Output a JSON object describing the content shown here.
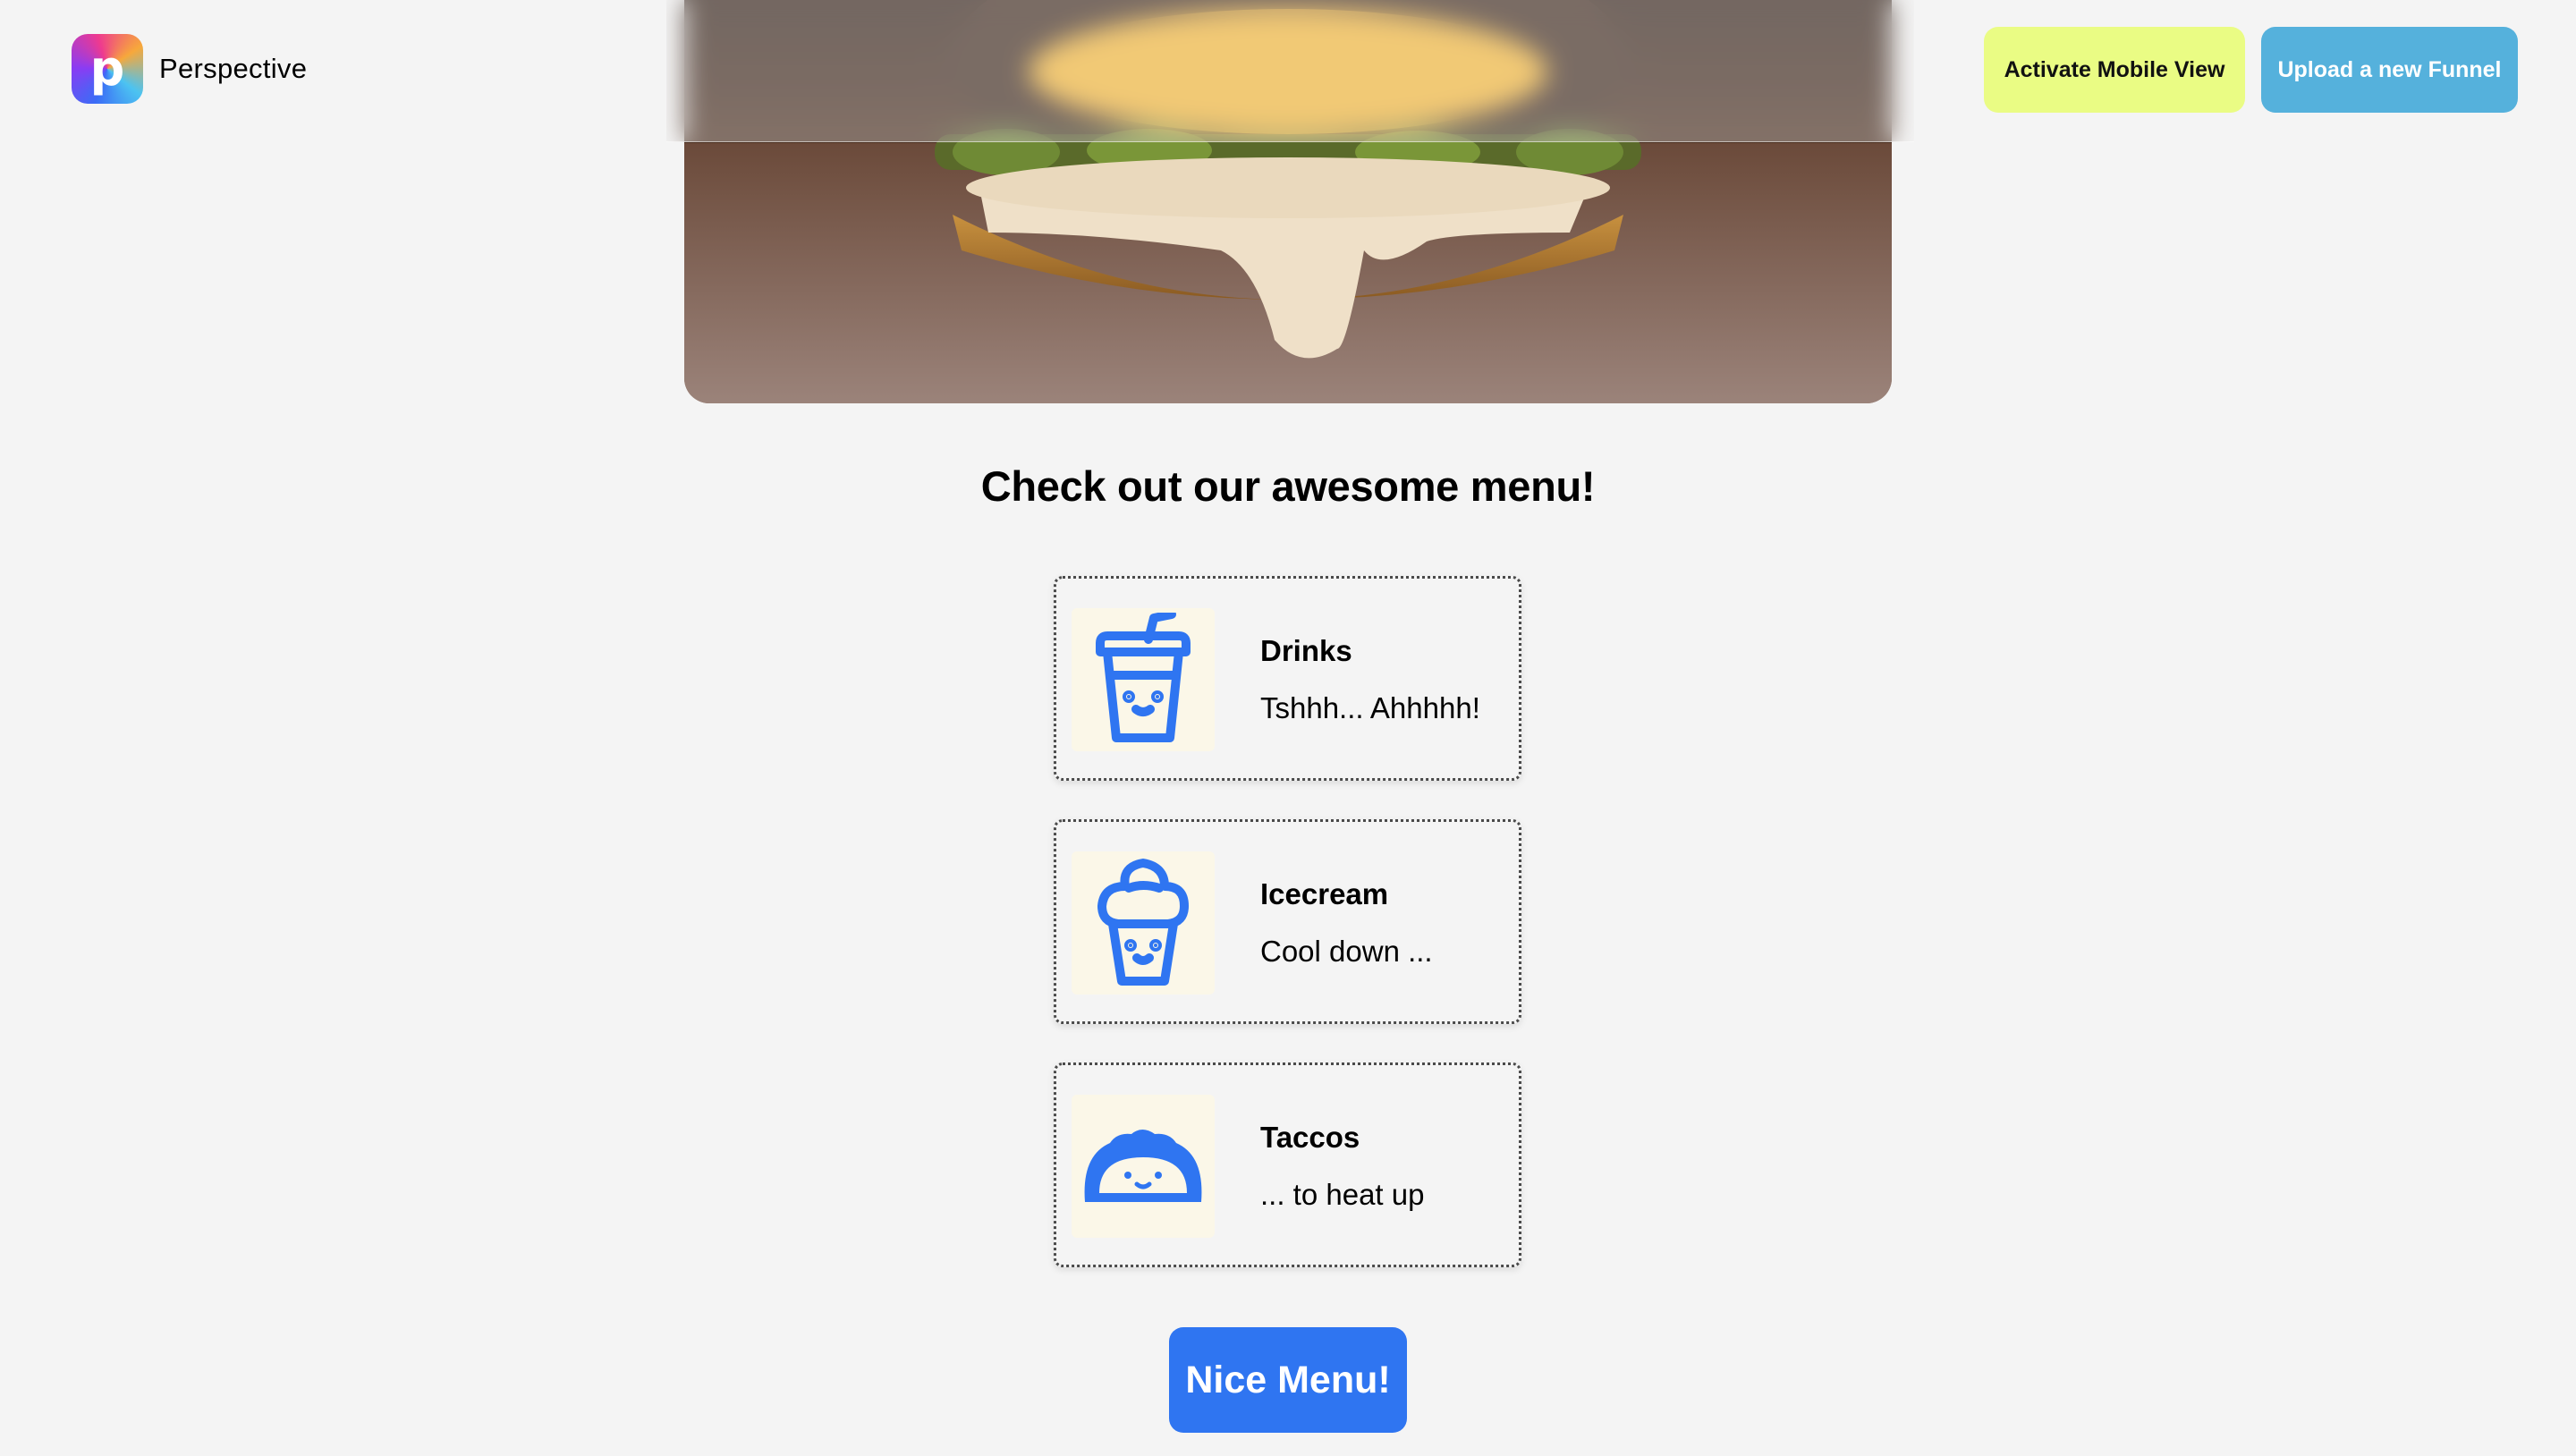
{
  "header": {
    "brand_name": "Perspective",
    "logo_letter": "p",
    "activate_mobile_label": "Activate Mobile View",
    "upload_funnel_label": "Upload a new Funnel"
  },
  "main": {
    "headline": "Check out our awesome menu!",
    "menu_items": [
      {
        "icon": "drink-cup-icon",
        "title": "Drinks",
        "description": "Tshhh... Ahhhhh!"
      },
      {
        "icon": "icecream-icon",
        "title": "Icecream",
        "description": "Cool down ..."
      },
      {
        "icon": "taco-icon",
        "title": "Taccos",
        "description": "... to heat up"
      }
    ],
    "cta_label": "Nice Menu!"
  },
  "colors": {
    "background": "#f4f4f4",
    "mobile_button": "#eafc84",
    "upload_button": "#55b1dc",
    "accent_blue": "#2f75f1",
    "icon_tile": "#fbf7e8"
  }
}
